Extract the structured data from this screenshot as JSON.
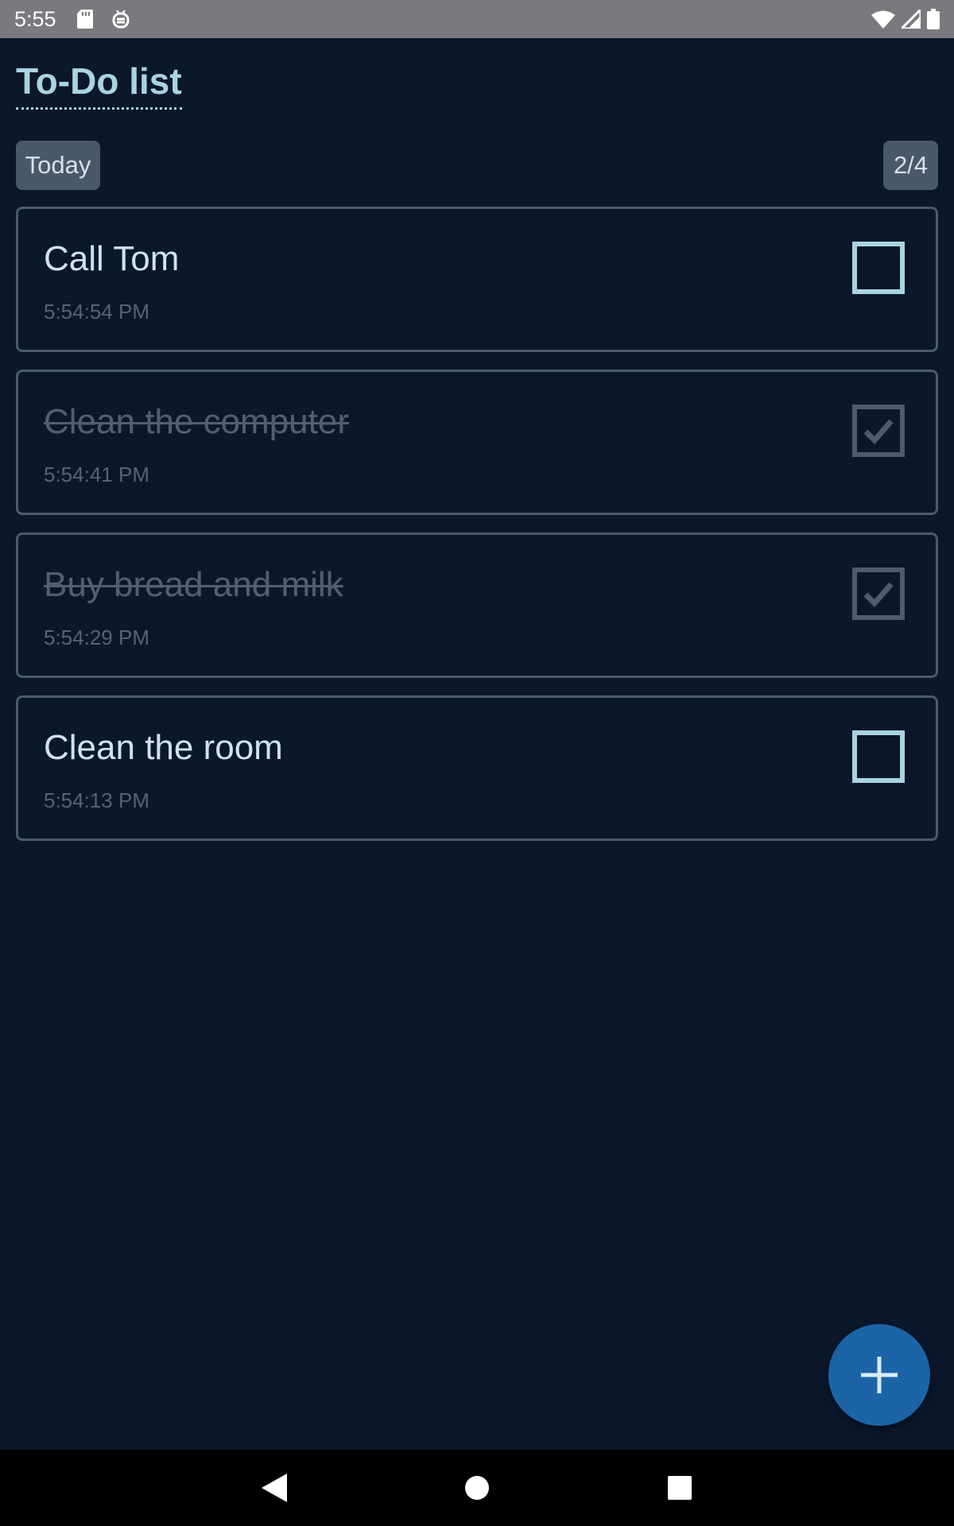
{
  "status_bar": {
    "time": "5:55",
    "icons": [
      "sd-card-icon",
      "debug-icon",
      "wifi-icon",
      "signal-icon",
      "battery-icon"
    ]
  },
  "header": {
    "title": "To-Do list"
  },
  "filter": {
    "day_label": "Today",
    "progress_label": "2/4"
  },
  "tasks": [
    {
      "title": "Call Tom",
      "time": "5:54:54 PM",
      "done": false
    },
    {
      "title": "Clean the computer",
      "time": "5:54:41 PM",
      "done": true
    },
    {
      "title": "Buy bread and milk",
      "time": "5:54:29 PM",
      "done": true
    },
    {
      "title": "Clean the room",
      "time": "5:54:13 PM",
      "done": false
    }
  ],
  "fab": {
    "icon": "plus-icon"
  },
  "nav_bar": {
    "icons": [
      "back-icon",
      "home-icon",
      "recents-icon"
    ]
  },
  "colors": {
    "background": "#0b172b",
    "accent": "#a9d3e3",
    "fab": "#1b64a8",
    "chip": "#4a586b",
    "card_border": "#4b5a6e"
  }
}
